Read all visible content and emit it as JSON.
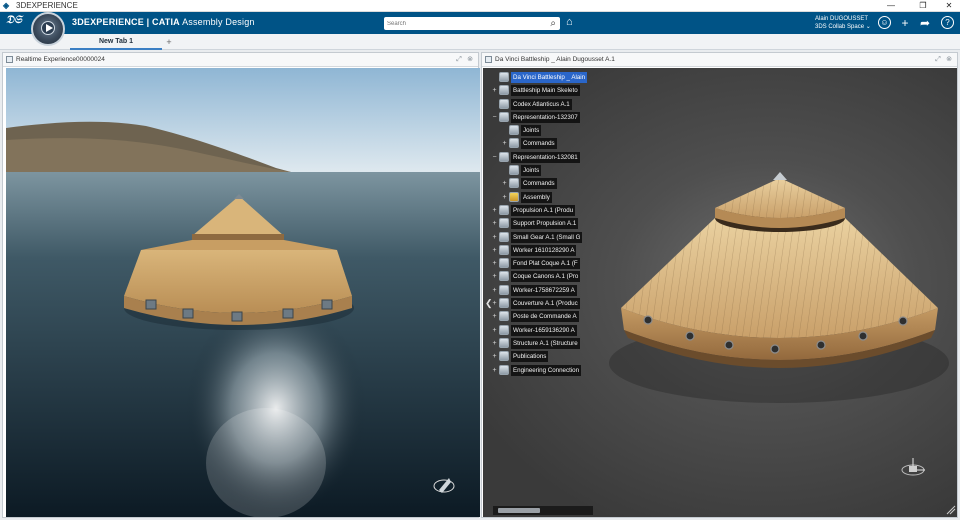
{
  "window": {
    "title": "3DEXPERIENCE",
    "controls": [
      "—",
      "❐",
      "✕"
    ]
  },
  "header": {
    "brand_strong": "3DEXPERIENCE | CATIA",
    "brand_app": " Assembly Design",
    "search_placeholder": "Search",
    "user_name": "Alain DUGOUSSET",
    "collab_space": "3DS Collab Space",
    "icons": [
      "tag-icon",
      "user-icon",
      "add-icon",
      "share-icon",
      "help-icon"
    ]
  },
  "tabs": {
    "active": "New Tab 1",
    "add": "+"
  },
  "left_panel": {
    "title": "Realtime Experience00000024"
  },
  "right_panel": {
    "title": "Da Vinci Battleship _ Alain Dugousset A.1",
    "tree": [
      {
        "label": "Da Vinci Battleship _ Alain",
        "level": 0,
        "toggle": "",
        "selected": true
      },
      {
        "label": "Battleship Main Skeleto",
        "level": 1,
        "toggle": "+"
      },
      {
        "label": "Codex Atlanticus A.1",
        "level": 1,
        "toggle": ""
      },
      {
        "label": "Representation-132307",
        "level": 1,
        "toggle": "−"
      },
      {
        "label": "Joints",
        "level": 2,
        "toggle": ""
      },
      {
        "label": "Commands",
        "level": 2,
        "toggle": "+"
      },
      {
        "label": "Representation-132081",
        "level": 1,
        "toggle": "−"
      },
      {
        "label": "Joints",
        "level": 2,
        "toggle": ""
      },
      {
        "label": "Commands",
        "level": 2,
        "toggle": "+"
      },
      {
        "label": "Assembly",
        "level": 2,
        "toggle": "+"
      },
      {
        "label": "Propulsion A.1 (Produ",
        "level": 1,
        "toggle": "+"
      },
      {
        "label": "Support Propulsion A.1",
        "level": 1,
        "toggle": "+"
      },
      {
        "label": "Small Gear A.1 (Small G",
        "level": 1,
        "toggle": "+"
      },
      {
        "label": "Worker 1610128290 A",
        "level": 1,
        "toggle": "+"
      },
      {
        "label": "Fond Plat Coque A.1 (F",
        "level": 1,
        "toggle": "+"
      },
      {
        "label": "Coque Canons A.1 (Pro",
        "level": 1,
        "toggle": "+"
      },
      {
        "label": "Worker-1758672259 A",
        "level": 1,
        "toggle": "+"
      },
      {
        "label": "Couverture A.1 (Produc",
        "level": 1,
        "toggle": "+"
      },
      {
        "label": "Poste de Commande A",
        "level": 1,
        "toggle": "+"
      },
      {
        "label": "Worker-1659136290 A",
        "level": 1,
        "toggle": "+"
      },
      {
        "label": "Structure A.1 (Structure",
        "level": 1,
        "toggle": "+"
      },
      {
        "label": "Publications",
        "level": 1,
        "toggle": "+"
      },
      {
        "label": "Engineering Connection",
        "level": 1,
        "toggle": "+"
      }
    ]
  },
  "colors": {
    "header": "#005386",
    "tree_selection": "#2a66c9",
    "tab_accent": "#3b7fc4"
  }
}
